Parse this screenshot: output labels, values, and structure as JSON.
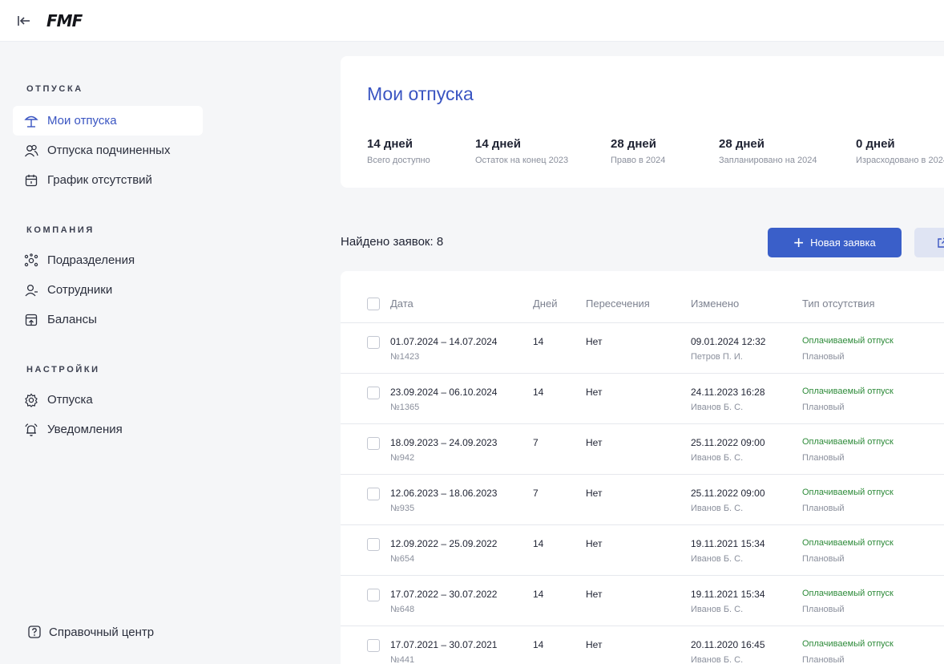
{
  "header": {
    "logo_text": "FMF"
  },
  "sidebar": {
    "sections": [
      {
        "title": "ОТПУСКА",
        "items": [
          {
            "label": "Мои отпуска",
            "icon": "beach-umbrella-icon",
            "active": true
          },
          {
            "label": "Отпуска подчиненных",
            "icon": "users-icon"
          },
          {
            "label": "График отсутствий",
            "icon": "calendar-icon"
          }
        ]
      },
      {
        "title": "КОМПАНИЯ",
        "items": [
          {
            "label": "Подразделения",
            "icon": "org-structure-icon"
          },
          {
            "label": "Сотрудники",
            "icon": "employees-icon"
          },
          {
            "label": "Балансы",
            "icon": "wallet-icon"
          }
        ]
      },
      {
        "title": "НАСТРОЙКИ",
        "items": [
          {
            "label": "Отпуска",
            "icon": "gear-icon"
          },
          {
            "label": "Уведомления",
            "icon": "alarm-icon"
          }
        ]
      }
    ],
    "help_label": "Справочный центр"
  },
  "summary": {
    "title": "Мои отпуска",
    "stats": [
      {
        "value": "14 дней",
        "label": "Всего доступно"
      },
      {
        "value": "14 дней",
        "label": "Остаток на конец 2023"
      },
      {
        "value": "28 дней",
        "label": "Право в 2024"
      },
      {
        "value": "28 дней",
        "label": "Запланировано на 2024"
      },
      {
        "value": "0 дней",
        "label": "Израсходовано в 2024"
      }
    ]
  },
  "list": {
    "found_text": "Найдено заявок: 8",
    "new_button_label": "Новая заявка",
    "columns": [
      "Дата",
      "Дней",
      "Пересечения",
      "Изменено",
      "Тип отсутствия"
    ],
    "rows": [
      {
        "dates": "01.07.2024 – 14.07.2024",
        "number": "№1423",
        "days": "14",
        "intersections": "Нет",
        "changed": "09.01.2024 12:32",
        "author": "Петров П. И.",
        "type": "Оплачиваемый отпуск",
        "kind": "Плановый"
      },
      {
        "dates": "23.09.2024 – 06.10.2024",
        "number": "№1365",
        "days": "14",
        "intersections": "Нет",
        "changed": "24.11.2023 16:28",
        "author": "Иванов Б. С.",
        "type": "Оплачиваемый отпуск",
        "kind": "Плановый"
      },
      {
        "dates": "18.09.2023 – 24.09.2023",
        "number": "№942",
        "days": "7",
        "intersections": "Нет",
        "changed": "25.11.2022 09:00",
        "author": "Иванов Б. С.",
        "type": "Оплачиваемый отпуск",
        "kind": "Плановый"
      },
      {
        "dates": "12.06.2023 – 18.06.2023",
        "number": "№935",
        "days": "7",
        "intersections": "Нет",
        "changed": "25.11.2022 09:00",
        "author": "Иванов Б. С.",
        "type": "Оплачиваемый отпуск",
        "kind": "Плановый"
      },
      {
        "dates": "12.09.2022 – 25.09.2022",
        "number": "№654",
        "days": "14",
        "intersections": "Нет",
        "changed": "19.11.2021 15:34",
        "author": "Иванов Б. С.",
        "type": "Оплачиваемый отпуск",
        "kind": "Плановый"
      },
      {
        "dates": "17.07.2022 – 30.07.2022",
        "number": "№648",
        "days": "14",
        "intersections": "Нет",
        "changed": "19.11.2021 15:34",
        "author": "Иванов Б. С.",
        "type": "Оплачиваемый отпуск",
        "kind": "Плановый"
      },
      {
        "dates": "17.07.2021 – 30.07.2021",
        "number": "№441",
        "days": "14",
        "intersections": "Нет",
        "changed": "20.11.2020 16:45",
        "author": "Иванов Б. С.",
        "type": "Оплачиваемый отпуск",
        "kind": "Плановый"
      }
    ]
  },
  "colors": {
    "accent": "#3a55c2",
    "button": "#3a5fc9",
    "status_green": "#2e8b3a",
    "muted": "#8a8f9c"
  }
}
